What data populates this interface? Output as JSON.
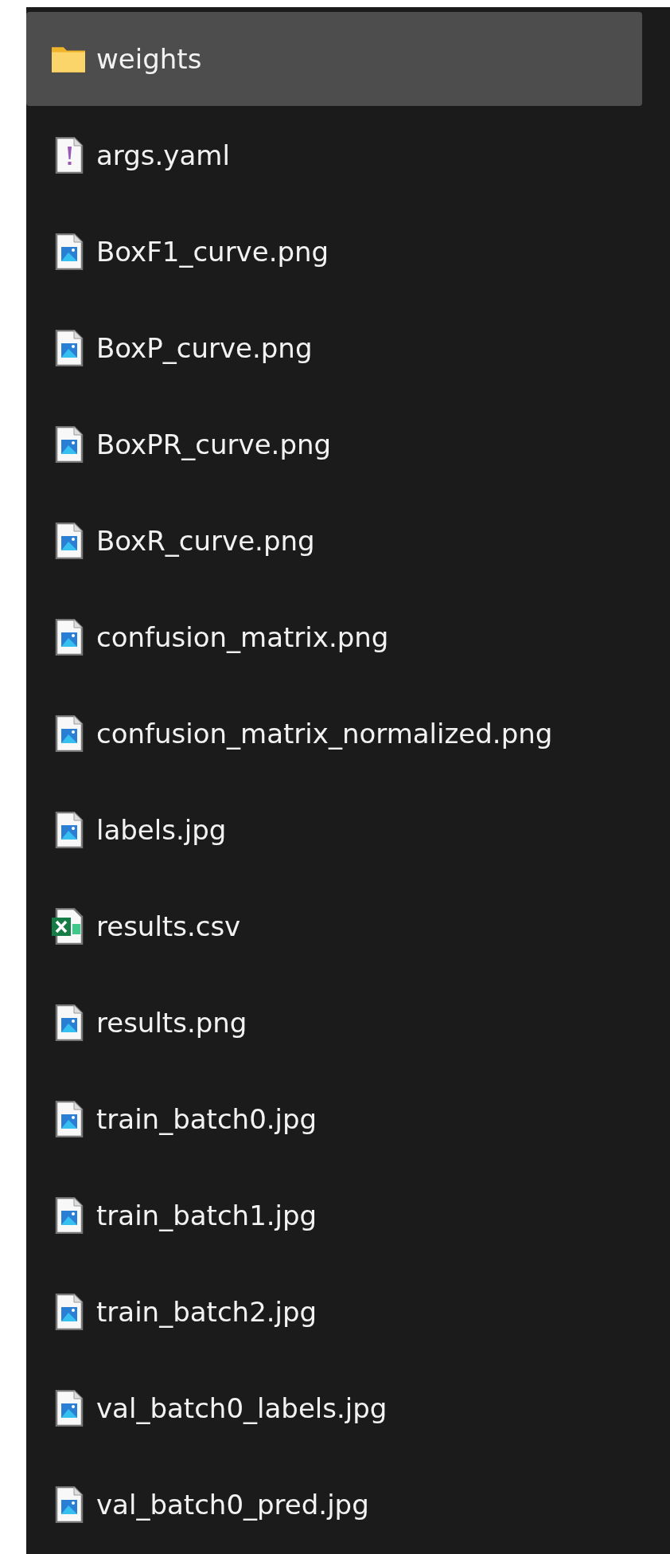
{
  "files": [
    {
      "name": "weights",
      "kind": "folder",
      "selected": true
    },
    {
      "name": "args.yaml",
      "kind": "yaml",
      "selected": false
    },
    {
      "name": "BoxF1_curve.png",
      "kind": "image",
      "selected": false
    },
    {
      "name": "BoxP_curve.png",
      "kind": "image",
      "selected": false
    },
    {
      "name": "BoxPR_curve.png",
      "kind": "image",
      "selected": false
    },
    {
      "name": "BoxR_curve.png",
      "kind": "image",
      "selected": false
    },
    {
      "name": "confusion_matrix.png",
      "kind": "image",
      "selected": false
    },
    {
      "name": "confusion_matrix_normalized.png",
      "kind": "image",
      "selected": false
    },
    {
      "name": "labels.jpg",
      "kind": "image",
      "selected": false
    },
    {
      "name": "results.csv",
      "kind": "csv",
      "selected": false
    },
    {
      "name": "results.png",
      "kind": "image",
      "selected": false
    },
    {
      "name": "train_batch0.jpg",
      "kind": "image",
      "selected": false
    },
    {
      "name": "train_batch1.jpg",
      "kind": "image",
      "selected": false
    },
    {
      "name": "train_batch2.jpg",
      "kind": "image",
      "selected": false
    },
    {
      "name": "val_batch0_labels.jpg",
      "kind": "image",
      "selected": false
    },
    {
      "name": "val_batch0_pred.jpg",
      "kind": "image",
      "selected": false
    }
  ]
}
